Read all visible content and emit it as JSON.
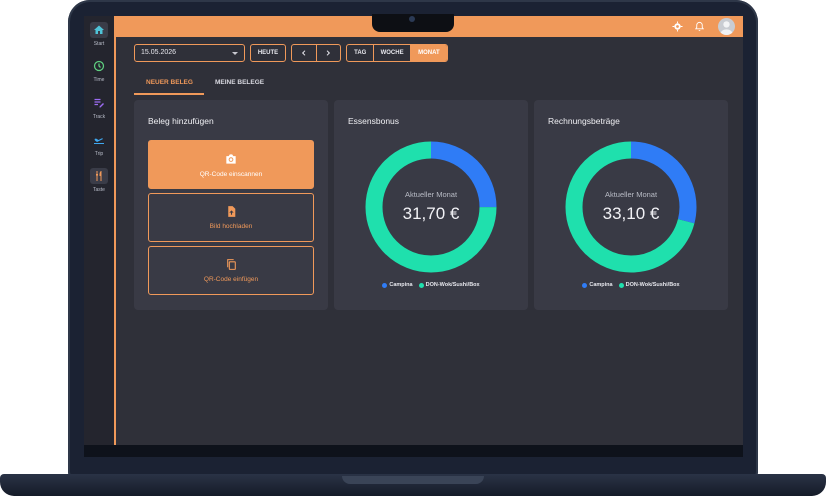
{
  "sidebar": {
    "items": [
      {
        "label": "Start",
        "icon": "home-icon",
        "color": "#4fc3d8"
      },
      {
        "label": "Time",
        "icon": "clock-icon",
        "color": "#5fd080"
      },
      {
        "label": "Track",
        "icon": "track-icon",
        "color": "#9b6cf2"
      },
      {
        "label": "Trip",
        "icon": "plane-icon",
        "color": "#3fa8f0"
      },
      {
        "label": "Taste",
        "icon": "fork-knife-icon",
        "color": "#f0995a"
      }
    ]
  },
  "toolbar": {
    "date_value": "15.05.2026",
    "today_label": "HEUTE",
    "prev_icon": "chevron-left-icon",
    "next_icon": "chevron-right-icon",
    "views": [
      "TAG",
      "WOCHE",
      "MONAT"
    ],
    "active_view": "MONAT"
  },
  "tabs": [
    {
      "label": "NEUER BELEG",
      "active": true
    },
    {
      "label": "MEINE BELEGE",
      "active": false
    }
  ],
  "add_card": {
    "title": "Beleg hinzufügen",
    "actions": [
      {
        "label": "QR-Code einscannen",
        "icon": "camera-icon"
      },
      {
        "label": "Bild hochladen",
        "icon": "upload-file-icon"
      },
      {
        "label": "QR-Code einfügen",
        "icon": "copy-icon"
      }
    ]
  },
  "colors": {
    "accent": "#f0995a",
    "campina": "#2f7cf6",
    "don": "#1fe0ad"
  },
  "chart_data": [
    {
      "type": "pie",
      "title": "Essensbonus",
      "center_label": "Aktueller Monat",
      "center_value": "31,70 €",
      "categories": [
        "Campina",
        "DON-Wok/Sushi/Box"
      ],
      "values": [
        0.25,
        0.75
      ]
    },
    {
      "type": "pie",
      "title": "Rechnungsbeträge",
      "center_label": "Aktueller Monat",
      "center_value": "33,10 €",
      "categories": [
        "Campina",
        "DON-Wok/Sushi/Box"
      ],
      "values": [
        0.29,
        0.71
      ]
    }
  ]
}
